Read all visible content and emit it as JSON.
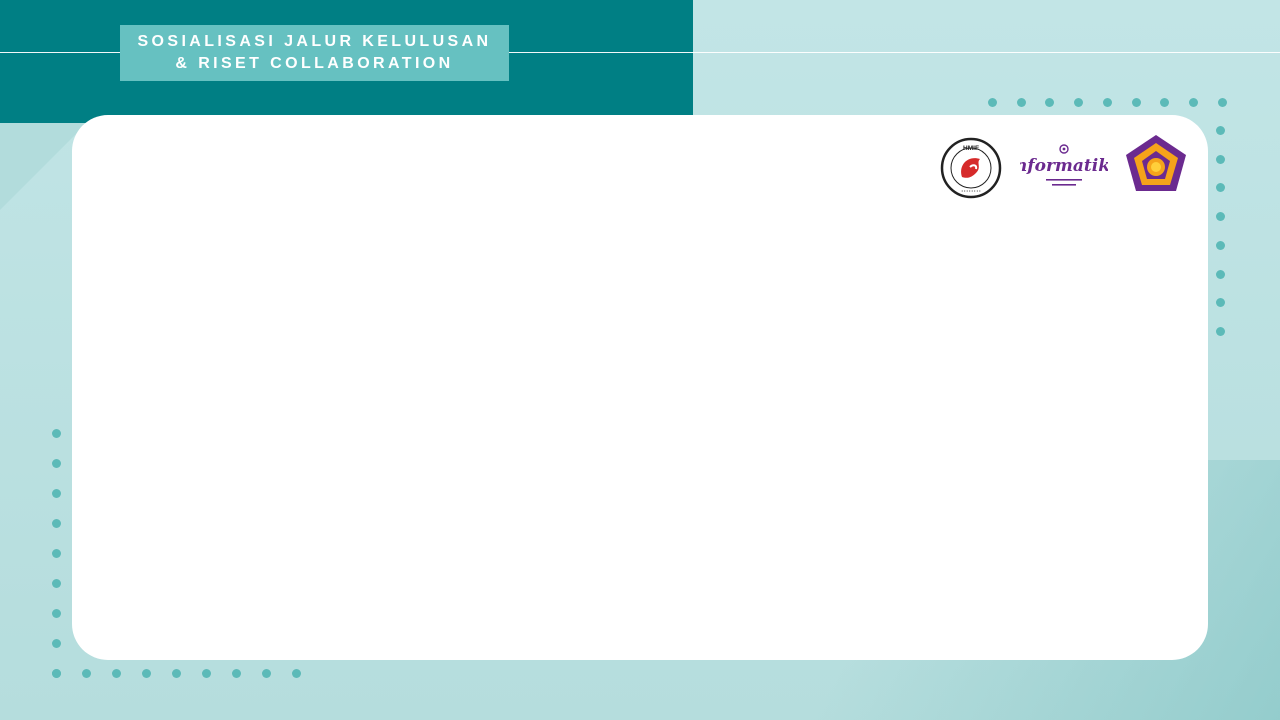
{
  "slide": {
    "title_line1": "SOSIALISASI JALUR KELULUSAN",
    "title_line2": "& RISET COLLABORATION"
  },
  "logos": {
    "hmif": {
      "icon": "hmif-logo-icon",
      "ring_text": "HMIF"
    },
    "informatika": {
      "icon": "informatika-logo-icon",
      "text": "Informatika"
    },
    "university": {
      "icon": "university-emblem-icon"
    }
  },
  "colors": {
    "teal_dark": "#007f84",
    "teal_box": "#66c1c1",
    "dot": "#5cbab8",
    "background": "#bfe3e3",
    "purple": "#6b2a8f",
    "orange": "#f5a31a"
  }
}
